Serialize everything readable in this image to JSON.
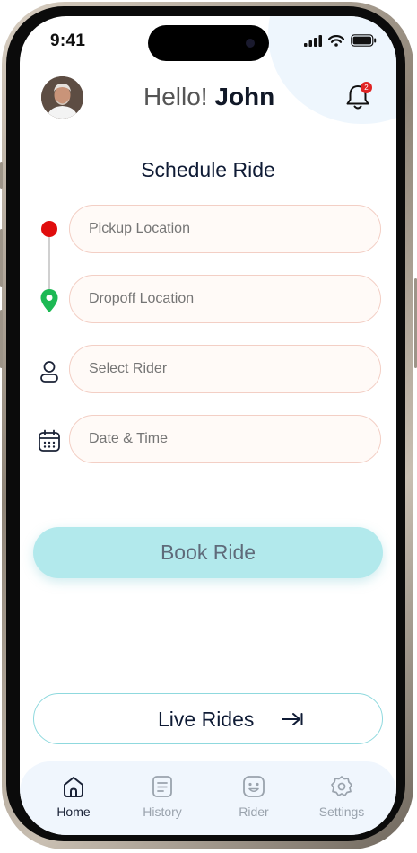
{
  "status_bar": {
    "time": "9:41"
  },
  "header": {
    "greeting": "Hello!",
    "user_name": "John",
    "notification_count": "2"
  },
  "form": {
    "title": "Schedule Ride",
    "pickup_placeholder": "Pickup Location",
    "dropoff_placeholder": "Dropoff Location",
    "rider_placeholder": "Select Rider",
    "datetime_placeholder": "Date & Time"
  },
  "actions": {
    "book_label": "Book Ride",
    "live_label": "Live Rides"
  },
  "tabbar": {
    "items": [
      {
        "label": "Home",
        "icon": "home-icon",
        "active": true
      },
      {
        "label": "History",
        "icon": "history-icon",
        "active": false
      },
      {
        "label": "Rider",
        "icon": "rider-icon",
        "active": false
      },
      {
        "label": "Settings",
        "icon": "settings-icon",
        "active": false
      }
    ]
  },
  "colors": {
    "accent": "#b2e9ec",
    "pickup_pin": "#e00d0d",
    "dropoff_pin": "#1db954",
    "badge": "#e02424"
  }
}
